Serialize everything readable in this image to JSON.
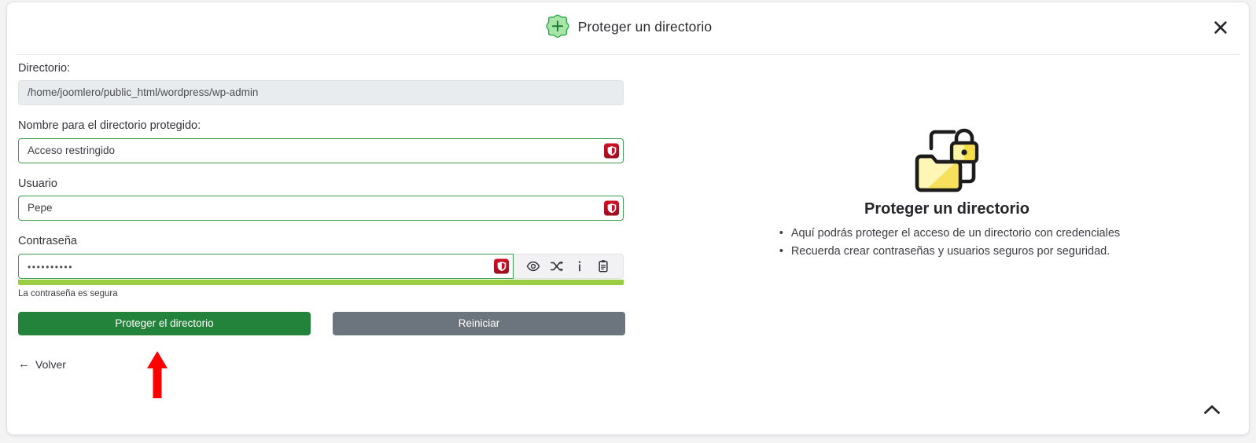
{
  "header": {
    "title": "Proteger un directorio",
    "add_icon": "plus-badge-icon",
    "close_icon": "close-icon"
  },
  "form": {
    "directory": {
      "label": "Directorio:",
      "value": "/home/joomlero/public_html/wordpress/wp-admin",
      "readonly": true
    },
    "protected_name": {
      "label": "Nombre para el directorio protegido:",
      "value": "Acceso restringido",
      "password_manager_icon": "bitwarden-shield-icon"
    },
    "user": {
      "label": "Usuario",
      "value": "Pepe",
      "password_manager_icon": "bitwarden-shield-icon"
    },
    "password": {
      "label": "Contraseña",
      "value": "••••••••••",
      "password_manager_icon": "bitwarden-shield-icon",
      "tools": [
        {
          "name": "eye-icon",
          "title": "Mostrar contraseña"
        },
        {
          "name": "shuffle-icon",
          "title": "Generar contraseña"
        },
        {
          "name": "info-icon",
          "title": "Información"
        },
        {
          "name": "clipboard-icon",
          "title": "Copiar"
        }
      ],
      "strength_text": "La contraseña es segura",
      "strength_color": "#9acd41"
    },
    "buttons": {
      "submit": "Proteger el directorio",
      "reset": "Reiniciar",
      "submit_color": "#24833b",
      "reset_color": "#6c757d"
    },
    "back_link": {
      "label": "Volver",
      "arrow": "←"
    }
  },
  "info": {
    "illustration": "folder-with-padlock-icon",
    "title": "Proteger un directorio",
    "bullets": [
      "Aquí podrás proteger el acceso de un directorio con credenciales",
      "Recuerda crear contraseñas y usuarios seguros por seguridad."
    ]
  },
  "annotation": {
    "arrow": "red-up-arrow-annotation",
    "color": "#fe0000"
  },
  "scroll_top": {
    "icon": "chevron-up-icon"
  }
}
